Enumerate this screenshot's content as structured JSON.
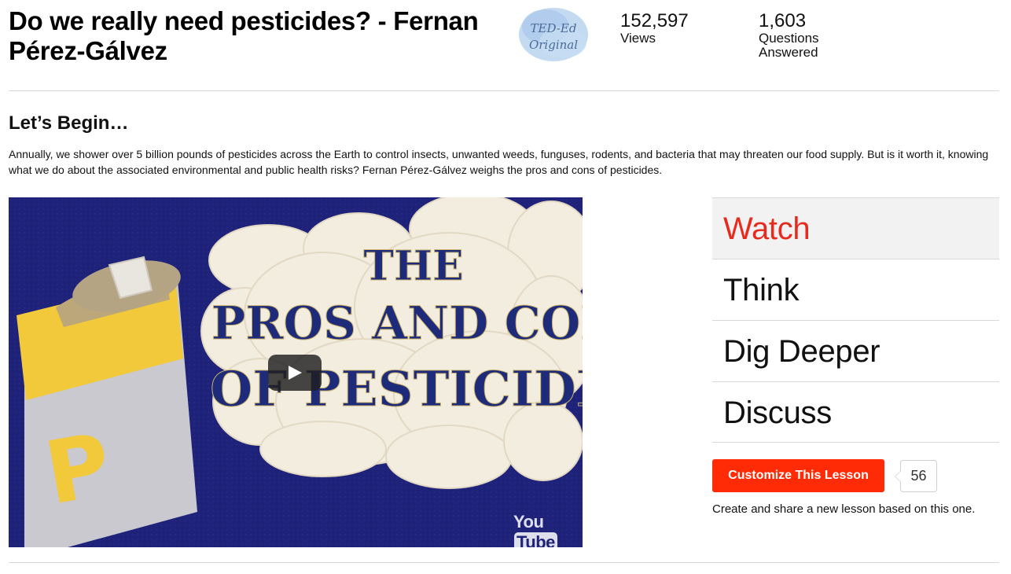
{
  "lesson": {
    "title": "Do we really need pesticides? - Fernan Pérez-Gálvez",
    "badge_line1": "TED-Ed",
    "badge_line2": "Original"
  },
  "stats": {
    "views": {
      "value": "152,597",
      "label": "Views"
    },
    "questions": {
      "value": "1,603",
      "label": "Questions Answered"
    }
  },
  "intro": {
    "heading": "Let’s Begin…",
    "description": "Annually, we shower over 5 billion pounds of pesticides across the Earth to control insects, unwanted weeds, funguses, rodents, and bacteria that may threaten our food supply. But is it worth it, knowing what we do about the associated environmental and public health risks? Fernan Pérez-Gálvez weighs the pros and cons of pesticides."
  },
  "video": {
    "title_line1": "THE",
    "title_line2": "PROS AND CONS",
    "title_line3": "OF PESTICIDES",
    "can_letter": "P",
    "logo_you": "You",
    "logo_tube": "Tube"
  },
  "tabs": [
    {
      "label": "Watch",
      "active": true
    },
    {
      "label": "Think",
      "active": false
    },
    {
      "label": "Dig Deeper",
      "active": false
    },
    {
      "label": "Discuss",
      "active": false
    }
  ],
  "customize": {
    "button_label": "Customize This Lesson",
    "count": "56",
    "note": "Create and share a new lesson based on this one."
  },
  "colors": {
    "accent": "#e62b1e",
    "button": "#ff2b06",
    "video_bg": "#1f2279"
  }
}
